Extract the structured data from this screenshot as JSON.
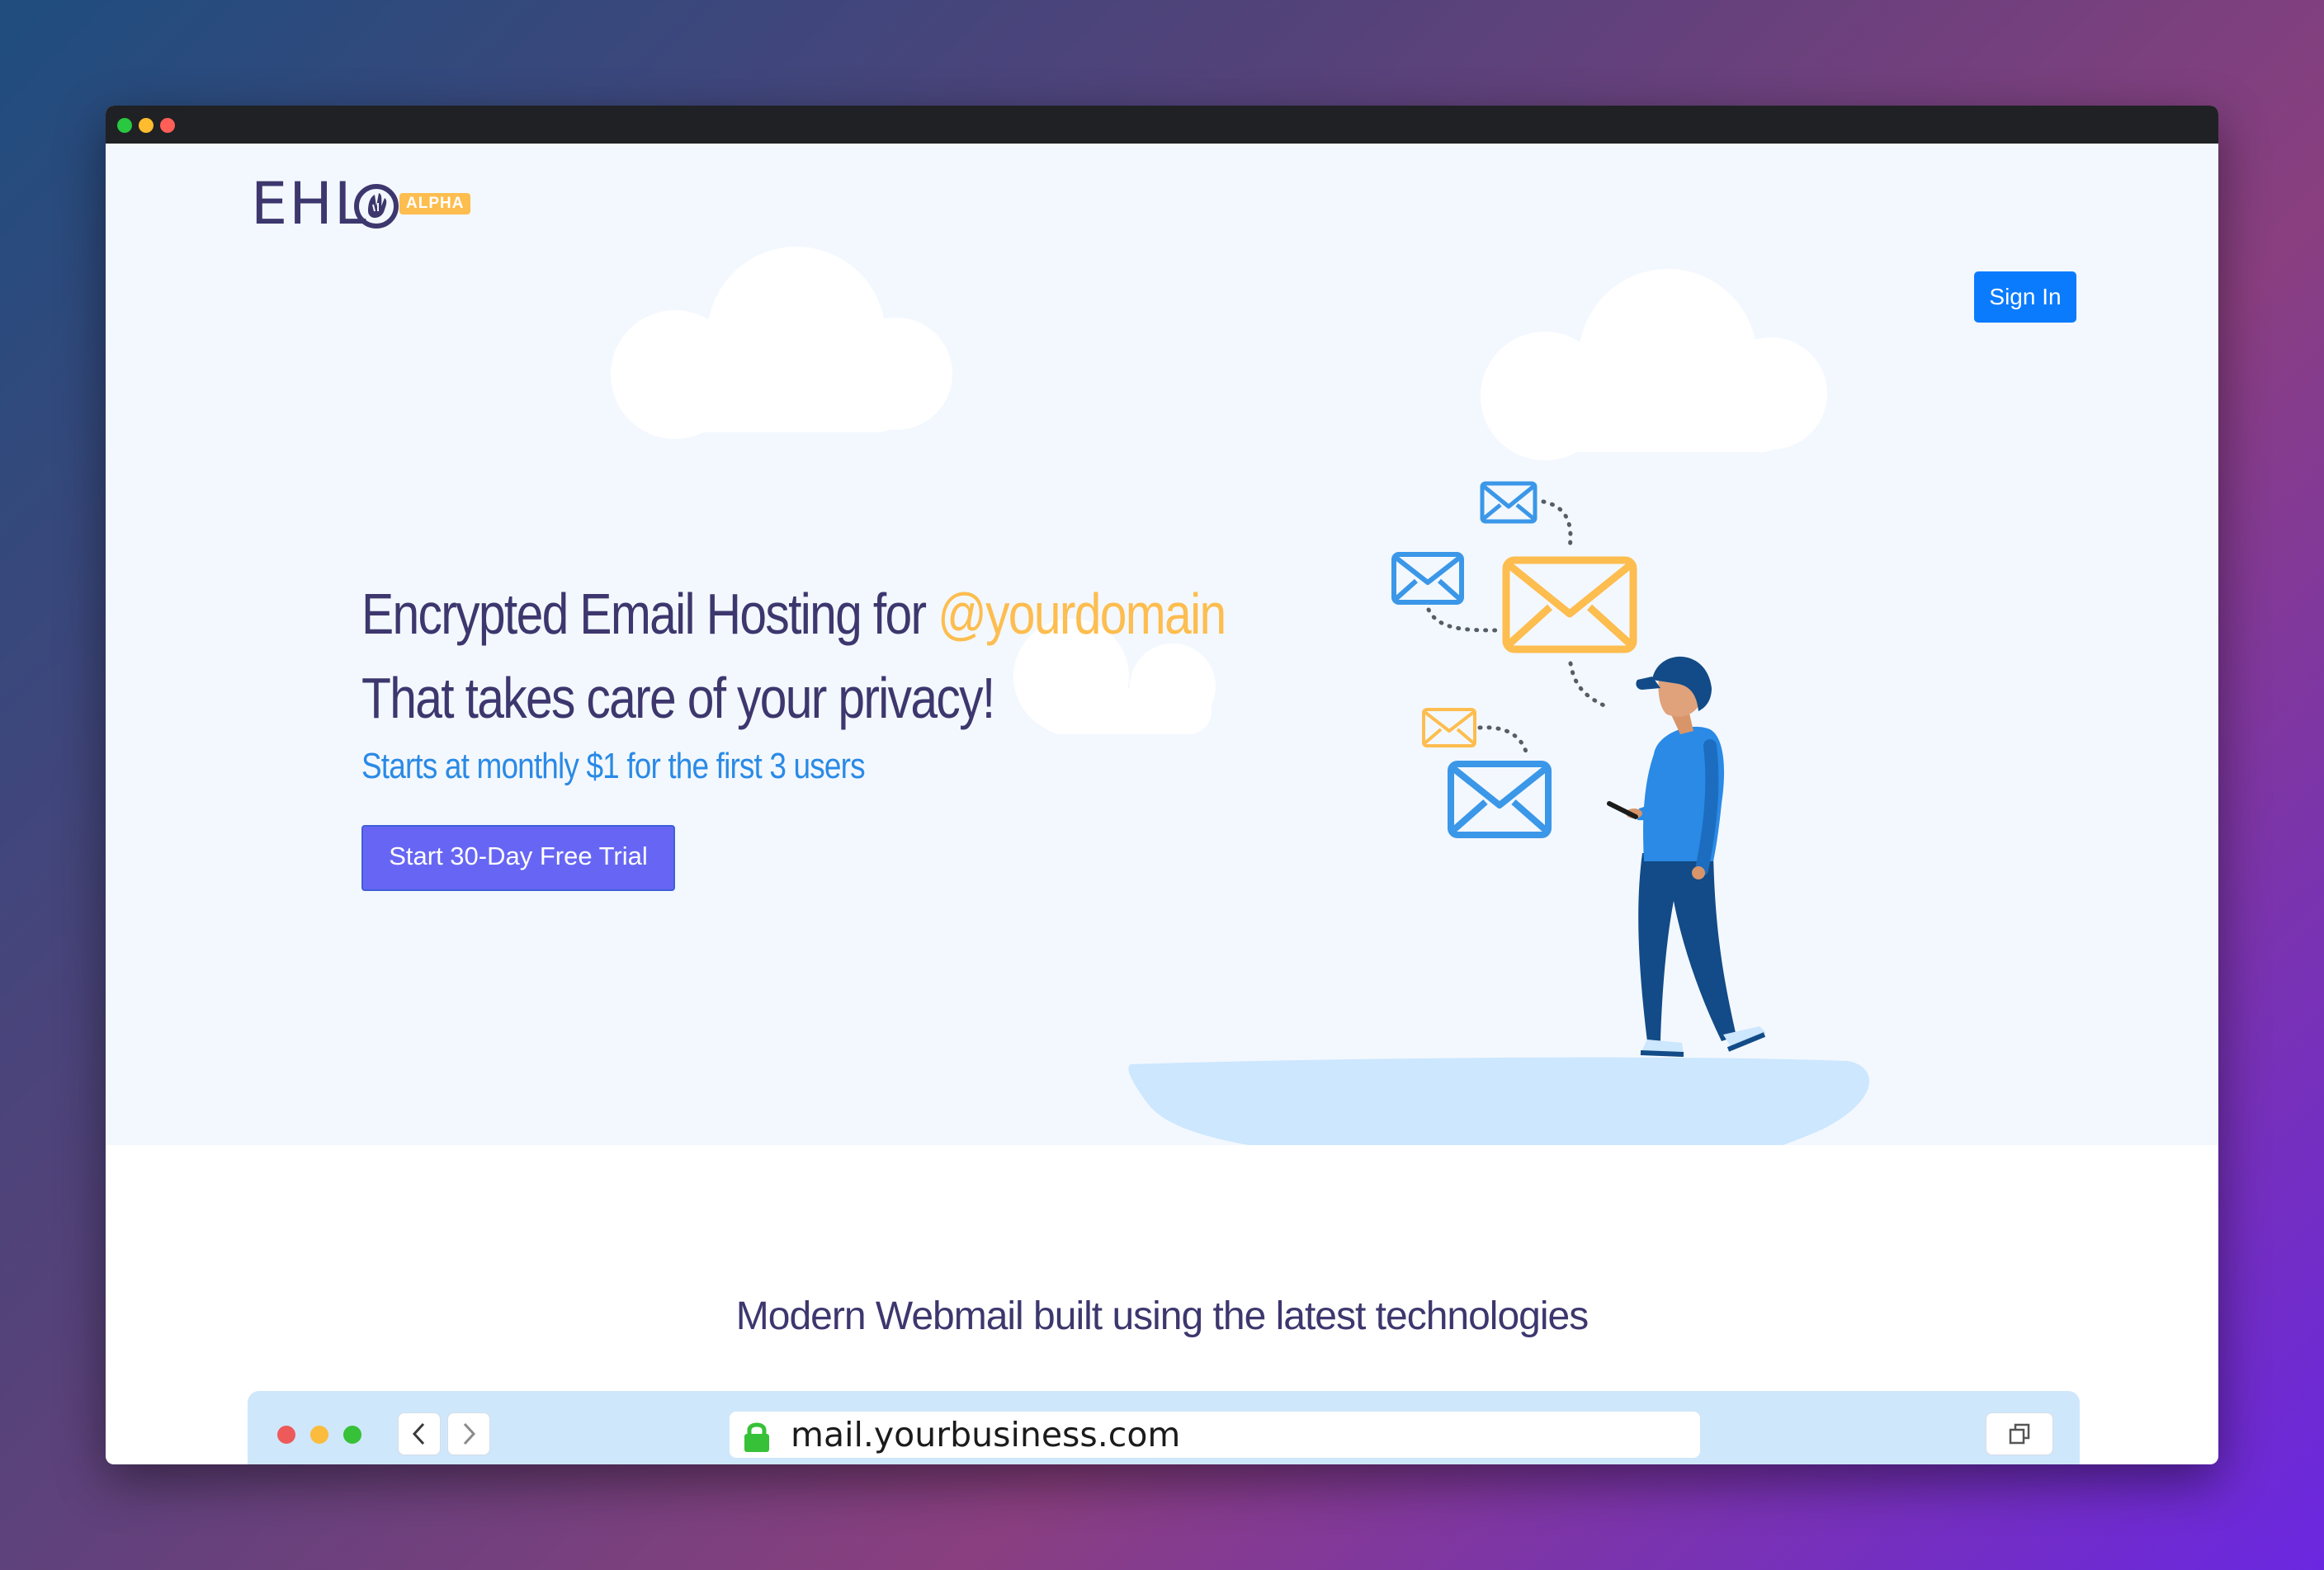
{
  "brand": {
    "logo_text": "EHL",
    "badge": "ALPHA",
    "colors": {
      "navy": "#3d376e",
      "accent": "#fdbd4f",
      "primary": "#0b7bfe",
      "cta": "#6766f4",
      "sky": "#2a8ae6"
    }
  },
  "nav": {
    "signin_label": "Sign In"
  },
  "hero": {
    "headline_part1": "Encrypted Email Hosting for ",
    "headline_domain": "@yourdomain",
    "headline_line2": "That takes care of your privacy!",
    "subline": "Starts at monthly $1 for the first 3 users",
    "cta_label": "Start 30-Day Free Trial"
  },
  "section": {
    "title": "Modern Webmail built using the latest technologies"
  },
  "mockup": {
    "url": "mail.yourbusiness.com",
    "icons": [
      "back-chevron-icon",
      "forward-chevron-icon",
      "lock-icon",
      "copy-window-icon"
    ]
  },
  "window": {
    "icons": [
      "traffic-light-green",
      "traffic-light-yellow",
      "traffic-light-red"
    ]
  }
}
